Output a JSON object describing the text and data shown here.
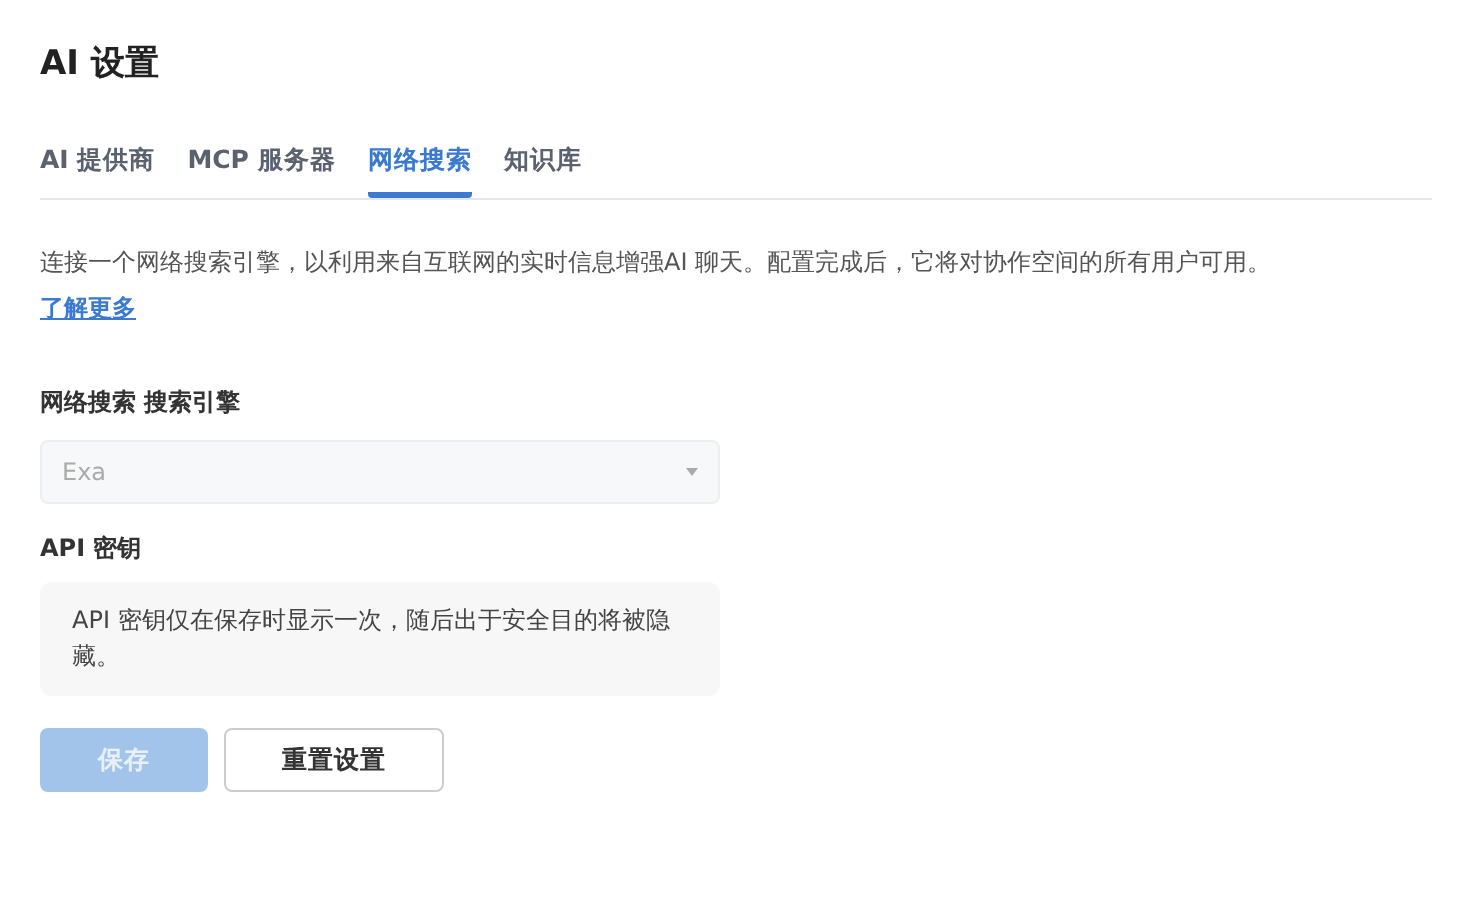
{
  "page": {
    "title": "AI 设置"
  },
  "tabs": [
    {
      "label": "AI 提供商",
      "selected": false
    },
    {
      "label": "MCP 服务器",
      "selected": false
    },
    {
      "label": "网络搜索",
      "selected": true
    },
    {
      "label": "知识库",
      "selected": false
    }
  ],
  "description": "连接一个网络搜索引擎，以利用来自互联网的实时信息增强AI 聊天。配置完成后，它将对协作空间的所有用户可用。",
  "learn_more_link": "了解更多",
  "search_engine": {
    "label": "网络搜索 搜索引擎",
    "value": "Exa",
    "disabled": true
  },
  "api_key": {
    "label": "API 密钥",
    "notice": "API 密钥仅在保存时显示一次，随后出于安全目的将被隐藏。"
  },
  "buttons": [
    {
      "label": "保存",
      "kind": "primary",
      "disabled": true
    },
    {
      "label": "重置设置",
      "kind": "secondary",
      "disabled": false
    }
  ]
}
